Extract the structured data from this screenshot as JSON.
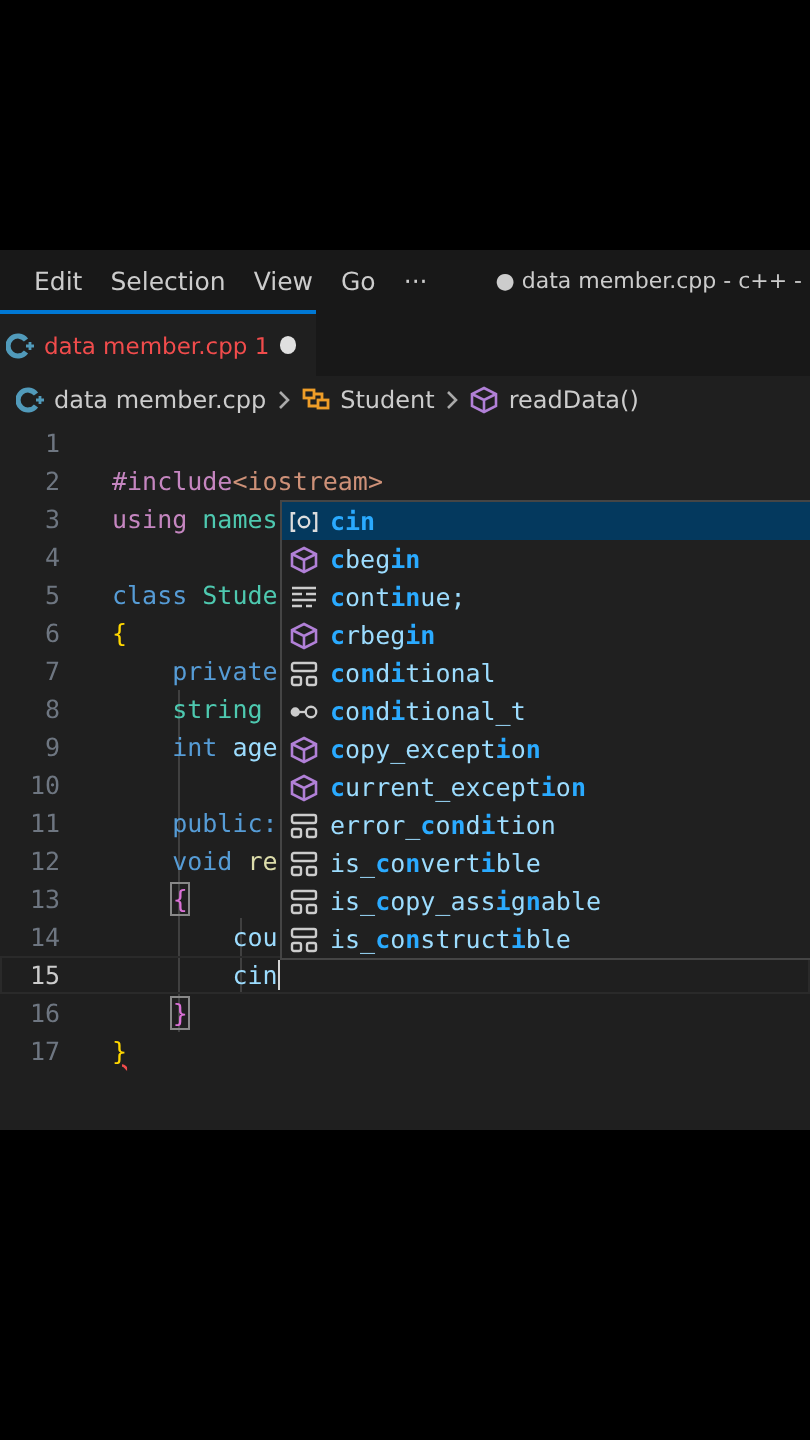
{
  "menu": [
    "Edit",
    "Selection",
    "View",
    "Go",
    "···"
  ],
  "window": {
    "title": "● data member.cpp - c++ -"
  },
  "tabs": [
    {
      "label": "data member.cpp 1",
      "selected": true,
      "modified": true,
      "has_errors": true
    }
  ],
  "breadcrumb": [
    {
      "kind": "file",
      "label": "data member.cpp"
    },
    {
      "kind": "class",
      "label": "Student"
    },
    {
      "kind": "method",
      "label": "readData()"
    }
  ],
  "lines": [
    {
      "number": "1",
      "current": false
    },
    {
      "number": "2",
      "current": false,
      "tokens": [
        {
          "kind": "directive",
          "text": "#include"
        },
        {
          "kind": "string",
          "text": "<iostream>"
        }
      ]
    },
    {
      "number": "3",
      "current": false,
      "tokens": [
        {
          "kind": "control",
          "text": "using "
        },
        {
          "kind": "namespace",
          "text": "names"
        }
      ]
    },
    {
      "number": "4",
      "current": false
    },
    {
      "number": "5",
      "current": false,
      "tokens": [
        {
          "kind": "keyword",
          "text": "class "
        },
        {
          "kind": "type",
          "text": "Stude"
        }
      ]
    },
    {
      "number": "6",
      "current": false,
      "tokens": [
        {
          "kind": "brace",
          "text": "{"
        }
      ]
    },
    {
      "number": "7",
      "current": false,
      "tokens": [
        {
          "kind": "keyword",
          "text": "    private"
        }
      ]
    },
    {
      "number": "8",
      "current": false,
      "tokens": [
        {
          "kind": "type",
          "text": "    string"
        }
      ]
    },
    {
      "number": "9",
      "current": false,
      "tokens": [
        {
          "kind": "keyword",
          "text": "    int "
        },
        {
          "kind": "variable",
          "text": "age"
        }
      ]
    },
    {
      "number": "10",
      "current": false
    },
    {
      "number": "11",
      "current": false,
      "tokens": [
        {
          "kind": "keyword",
          "text": "    public:"
        }
      ]
    },
    {
      "number": "12",
      "current": false,
      "tokens": [
        {
          "kind": "keyword",
          "text": "    void "
        },
        {
          "kind": "function",
          "text": "re"
        }
      ]
    },
    {
      "number": "13",
      "current": false,
      "tokens": [
        {
          "kind": "bracket",
          "text": "{",
          "indent": true
        }
      ]
    },
    {
      "number": "14",
      "current": false,
      "tokens": [
        {
          "kind": "variable",
          "text": "        cou"
        }
      ]
    },
    {
      "number": "15",
      "current": true,
      "tokens": [
        {
          "kind": "variable",
          "text": "        cin"
        }
      ]
    },
    {
      "number": "16",
      "current": false,
      "tokens": [
        {
          "kind": "bracket",
          "text": "}",
          "indent": true
        }
      ]
    },
    {
      "number": "17",
      "current": false,
      "tokens": [
        {
          "kind": "error_brace",
          "text": "}"
        }
      ]
    }
  ],
  "suggestions": [
    {
      "kind": "variable",
      "label": "cin",
      "selected": true
    },
    {
      "kind": "method",
      "label": "**c**beg**in**",
      "selected": false
    },
    {
      "kind": "keyword",
      "label": "**c**ont**in**ue;",
      "selected": false
    },
    {
      "kind": "method",
      "label": "**c**rbeg**in**",
      "selected": false
    },
    {
      "kind": "struct",
      "label": "**c**o**n**d**i**tional",
      "selected": false
    },
    {
      "kind": "alias",
      "label": "**c**o**n**d**i**tional_t",
      "selected": false
    },
    {
      "kind": "method",
      "label": "**c**opy_except**i**o**n**",
      "selected": false
    },
    {
      "kind": "method",
      "label": "**c**urrent_except**i**o**n**",
      "selected": false
    },
    {
      "kind": "struct",
      "label": "error_**c**o**n**d**i**tion",
      "selected": false
    },
    {
      "kind": "struct",
      "label": "is_**c**o**n**vert**i**ble",
      "selected": false
    },
    {
      "kind": "struct",
      "label": "is_**c**opy_ass**i**g**n**able",
      "selected": false
    },
    {
      "kind": "struct",
      "label": "is_**c**o**n**struct**i**ble",
      "selected": false
    }
  ]
}
